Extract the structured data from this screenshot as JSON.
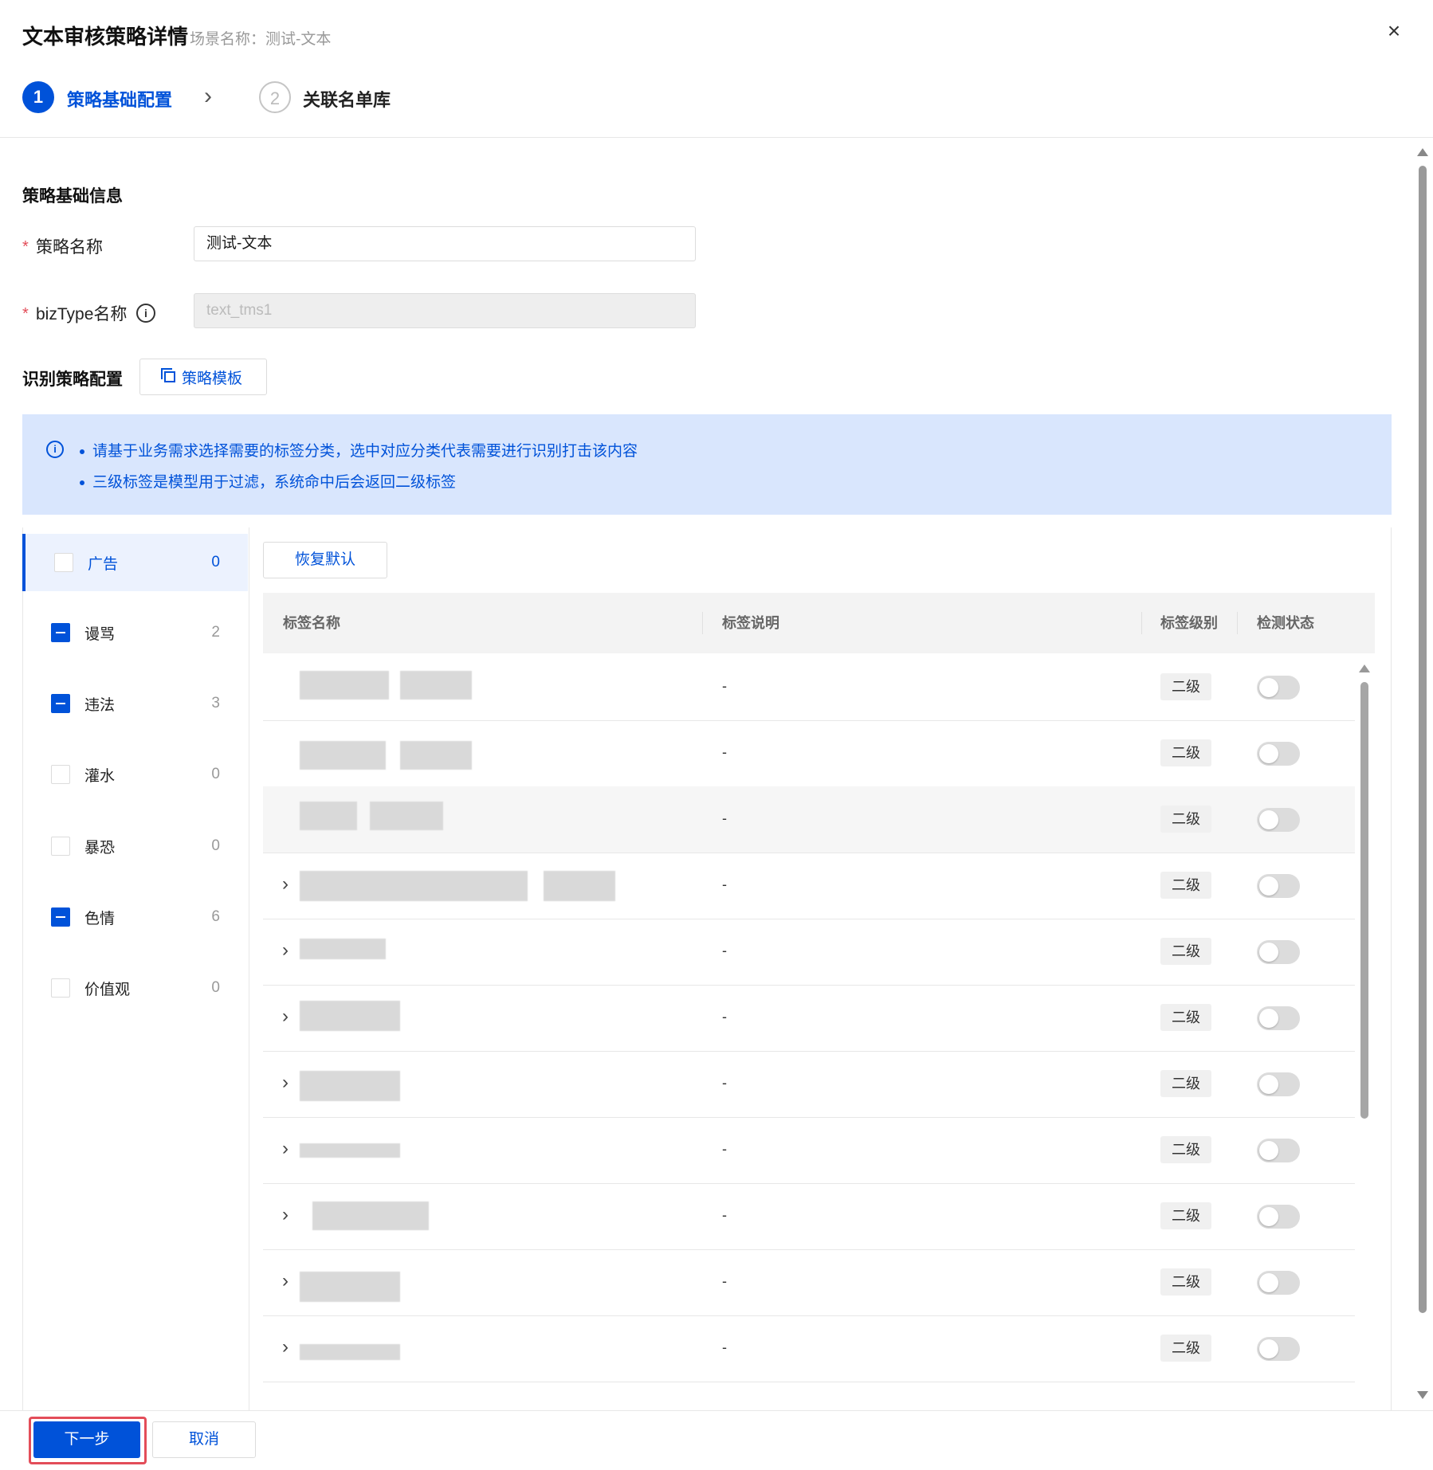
{
  "header": {
    "title": "文本审核策略详情",
    "subtitle": "场景名称：测试-文本",
    "close_glyph": "×"
  },
  "steps": [
    {
      "number": "1",
      "label": "策略基础配置",
      "active": true
    },
    {
      "number": "2",
      "label": "关联名单库",
      "active": false
    }
  ],
  "basic_section": {
    "title": "策略基础信息",
    "policy_name_label": "策略名称",
    "policy_name_value": "测试-文本",
    "biztype_label": "bizType名称",
    "biztype_value": "text_tms1",
    "required_mark": "*"
  },
  "recognition_section": {
    "title": "识别策略配置",
    "template_button": "策略模板"
  },
  "alert": {
    "lines": [
      "请基于业务需求选择需要的标签分类，选中对应分类代表需要进行识别打击该内容",
      "三级标签是模型用于过滤，系统命中后会返回二级标签"
    ]
  },
  "categories": [
    {
      "name": "广告",
      "count": "0",
      "state": "unchecked",
      "active": true
    },
    {
      "name": "谩骂",
      "count": "2",
      "state": "indeterminate",
      "active": false
    },
    {
      "name": "违法",
      "count": "3",
      "state": "indeterminate",
      "active": false
    },
    {
      "name": "灌水",
      "count": "0",
      "state": "unchecked",
      "active": false
    },
    {
      "name": "暴恐",
      "count": "0",
      "state": "unchecked",
      "active": false
    },
    {
      "name": "色情",
      "count": "6",
      "state": "indeterminate",
      "active": false
    },
    {
      "name": "价值观",
      "count": "0",
      "state": "unchecked",
      "active": false
    }
  ],
  "table": {
    "restore_button": "恢复默认",
    "columns": [
      "标签名称",
      "标签说明",
      "标签级别",
      "检测状态"
    ],
    "rows": [
      {
        "desc": "-",
        "level": "二级",
        "enabled": false,
        "expandable": false
      },
      {
        "desc": "-",
        "level": "二级",
        "enabled": false,
        "expandable": false
      },
      {
        "desc": "-",
        "level": "二级",
        "enabled": false,
        "expandable": false
      },
      {
        "desc": "-",
        "level": "二级",
        "enabled": false,
        "expandable": true
      },
      {
        "desc": "-",
        "level": "二级",
        "enabled": false,
        "expandable": true
      },
      {
        "desc": "-",
        "level": "二级",
        "enabled": false,
        "expandable": true
      },
      {
        "desc": "-",
        "level": "二级",
        "enabled": false,
        "expandable": true
      },
      {
        "desc": "-",
        "level": "二级",
        "enabled": false,
        "expandable": true
      },
      {
        "desc": "-",
        "level": "二级",
        "enabled": false,
        "expandable": true
      },
      {
        "desc": "-",
        "level": "二级",
        "enabled": false,
        "expandable": true
      },
      {
        "desc": "-",
        "level": "二级",
        "enabled": false,
        "expandable": true
      }
    ]
  },
  "footer": {
    "next_button": "下一步",
    "cancel_button": "取消"
  },
  "colors": {
    "primary": "#0052d9",
    "required": "#e34d59",
    "alert_bg": "#d9e6fd",
    "highlight_outline": "#e34d59"
  }
}
